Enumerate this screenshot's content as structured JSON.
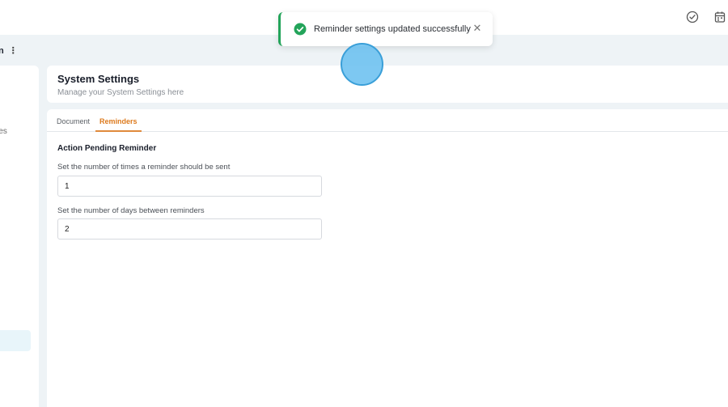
{
  "header": {
    "title_fragment": "n",
    "menu_icon": "kebab-icon",
    "icons": [
      "check-circle-icon",
      "calendar-icon"
    ]
  },
  "sidebar": {
    "visible_item_fragment": "ates"
  },
  "page": {
    "title": "System Settings",
    "subtitle": "Manage your System Settings here"
  },
  "tabs": [
    {
      "label": "Document",
      "active": false
    },
    {
      "label": "Reminders",
      "active": true
    }
  ],
  "reminders": {
    "section_title": "Action Pending Reminder",
    "times_label": "Set the number of times a reminder should be sent",
    "times_value": "1",
    "days_label": "Set the number of days between reminders",
    "days_value": "2"
  },
  "toast": {
    "message": "Reminder settings updated successfully",
    "icon": "success-check-icon",
    "close_icon": "close-icon",
    "accent_color": "#23a45a"
  },
  "colors": {
    "accent": "#dd7a1d",
    "background": "#eef3f6",
    "success": "#23a45a"
  }
}
